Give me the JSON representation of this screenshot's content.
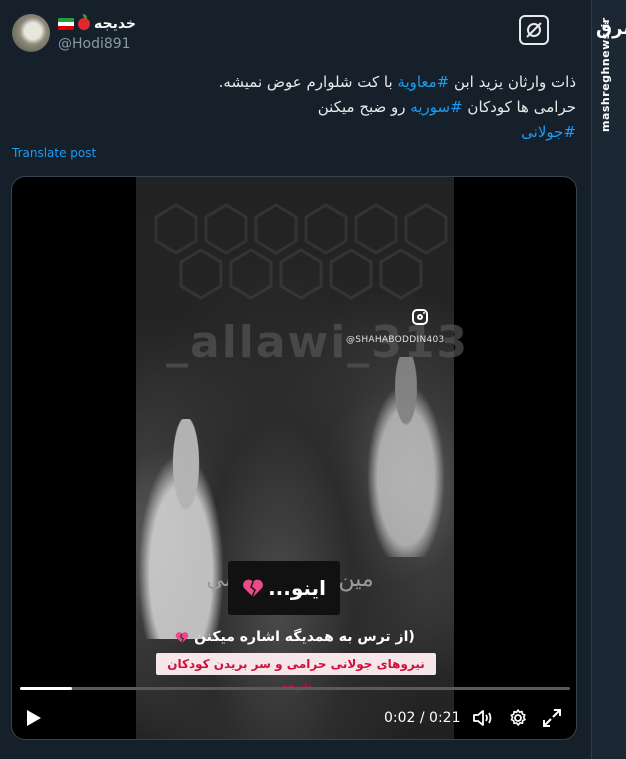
{
  "author": {
    "display_name": "خدیجه",
    "handle": "@Hodi891",
    "flag_icon": "iran-flag-icon",
    "emoji_icon": "red-apple-icon"
  },
  "post": {
    "line1_pre": "ذات وارثان یزید ابن ",
    "line1_tag": "#معاویة",
    "line1_post": "  با کت شلوارم عوض نمیشه.",
    "line2_pre": "حرامی ها کودکان ",
    "line2_tag": "#سوریه",
    "line2_post": " رو ضبح میکنن",
    "line3_tag": "#جولانی"
  },
  "translate_label": "Translate post",
  "brand": {
    "logo_text": "مشرق",
    "site": "mashreghnews.ir"
  },
  "video": {
    "bg_watermark": "_allawi_313",
    "ig_handle": "@SHAHABODDIN403",
    "bg_arabic": "مين بدنا ... ل شي",
    "caption": "اینو...",
    "subline": "(از ترس به همدیگه اشاره میکنن",
    "pink_caption": "نیروهای جولانی حرامی و سر بریدن کودکان شیعه",
    "progress": 0.095,
    "time_display": "0:02 / 0:21"
  },
  "colors": {
    "link": "#1d9bf0",
    "background": "#15202b",
    "pink_text": "#d0103a"
  }
}
